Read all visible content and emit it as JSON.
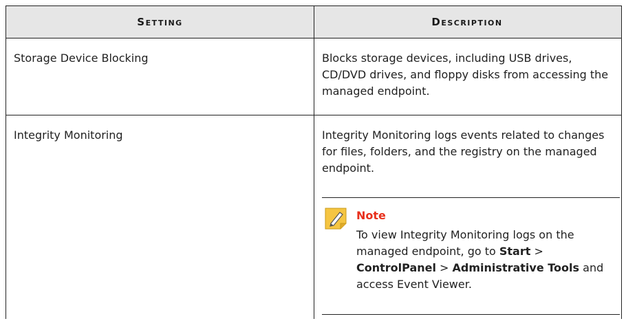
{
  "table": {
    "headers": {
      "setting": "Setting",
      "description": "Description"
    },
    "rows": [
      {
        "setting": "Storage Device Blocking",
        "description": "Blocks storage devices, including USB drives, CD/DVD drives, and floppy disks from accessing the managed endpoint."
      },
      {
        "setting": "Integrity Monitoring",
        "description": "Integrity Monitoring logs events related to changes for files, folders, and the registry on the managed endpoint."
      }
    ]
  },
  "note": {
    "title": "Note",
    "text_1": "To view Integrity Monitoring logs on the managed endpoint, go to ",
    "bold_1": "Start",
    "text_2": " > ",
    "bold_2": "ControlPanel",
    "text_3": " > ",
    "bold_3": "Administrative Tools",
    "text_4": " and access Event Viewer.",
    "icon": "note-pencil-icon",
    "title_color": "#e8301c",
    "icon_color": "#f5c542"
  }
}
